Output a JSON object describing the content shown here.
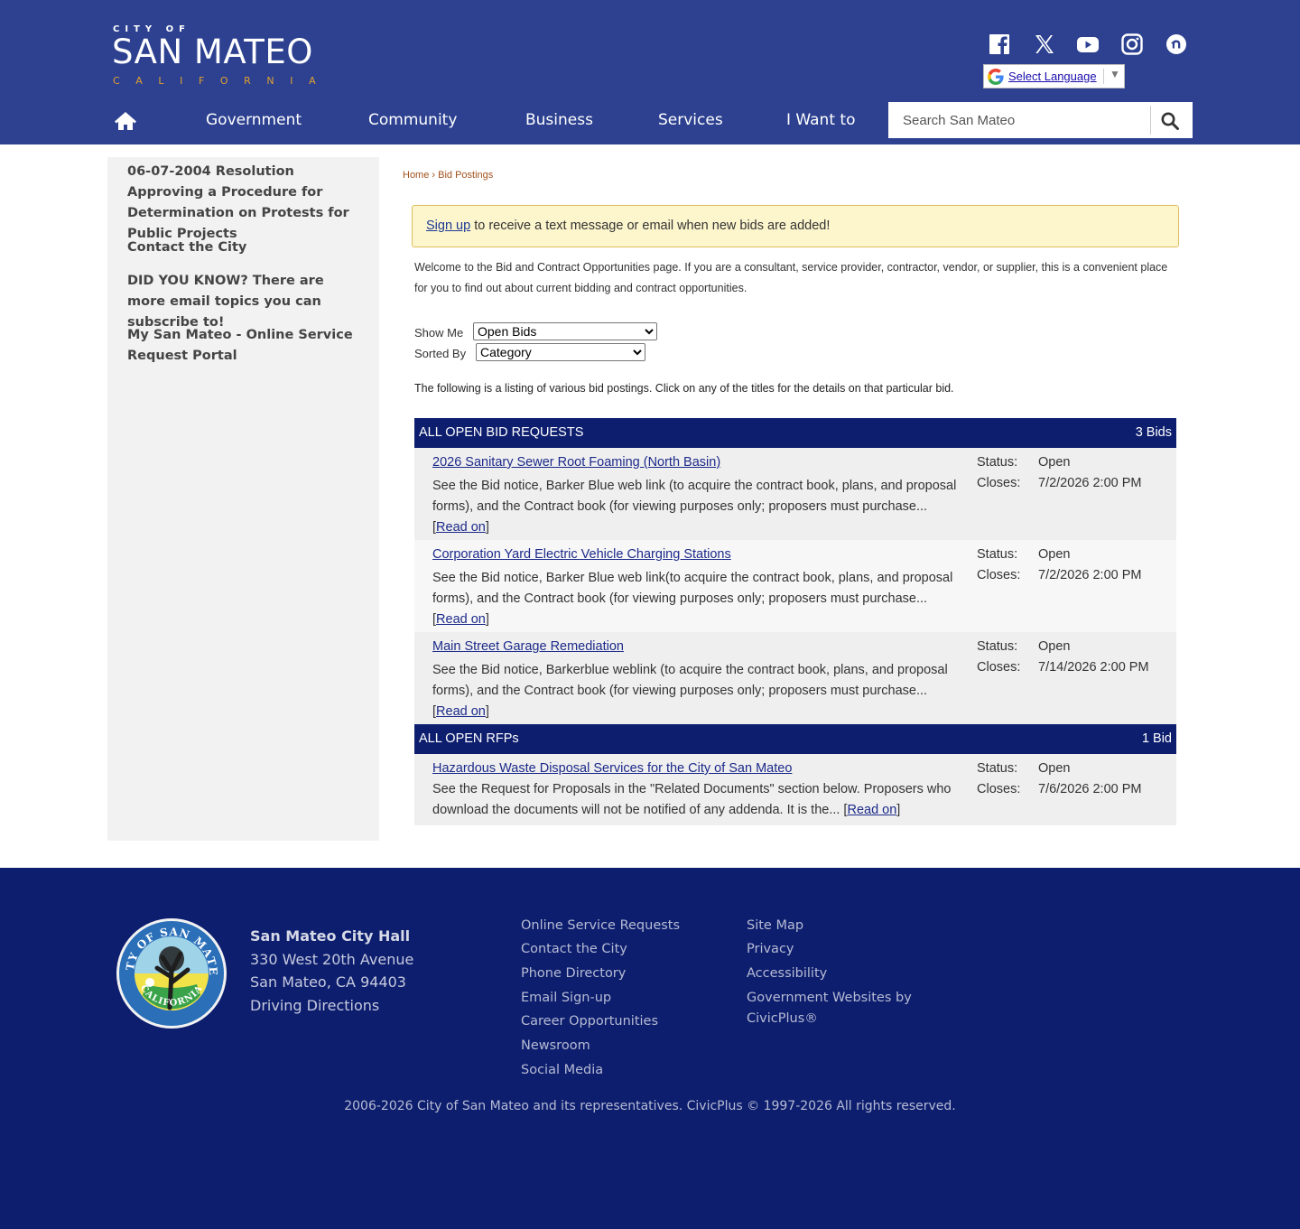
{
  "logo": {
    "line1": "CITY OF",
    "line2": "SAN MATEO",
    "line3": "CALIFORNIA"
  },
  "social": {
    "icons": [
      "facebook-icon",
      "x-twitter-icon",
      "youtube-icon",
      "instagram-icon",
      "nextdoor-icon"
    ]
  },
  "translate": {
    "label": "Select Language",
    "arrow": "▼"
  },
  "nav": {
    "items": [
      "Government",
      "Community",
      "Business",
      "Services",
      "I Want to"
    ]
  },
  "search": {
    "placeholder": "Search San Mateo"
  },
  "sidebar": {
    "items": [
      "06-07-2004 Resolution Approving a Procedure for Determination on Protests for Public Projects",
      "Contact the City",
      "DID YOU KNOW? There are more email topics you can subscribe to!",
      "My San Mateo - Online Service Request Portal"
    ]
  },
  "breadcrumb": {
    "home": "Home",
    "sep": " › ",
    "current": "Bid Postings"
  },
  "alert": {
    "link": "Sign up",
    "text": " to receive a text message or email when new bids are added!"
  },
  "intro": "Welcome to the Bid and Contract Opportunities page. If you are a consultant, service provider, contractor, vendor, or supplier, this is a convenient place for you to find out about current bidding and contract opportunities.",
  "filters": {
    "show_label": "Show Me",
    "show_value": "Open Bids",
    "sort_label": "Sorted By",
    "sort_value": "Category"
  },
  "listing_note": "The following is a listing of various bid postings. Click on any of the titles for the details on that particular bid.",
  "categories": [
    {
      "title": "ALL OPEN BID REQUESTS",
      "count": "3 Bids",
      "bids": [
        {
          "title": "2026 Sanitary Sewer Root Foaming (North Basin)",
          "desc": "See the Bid notice, Barker Blue web link (to acquire the contract book, plans, and proposal forms), and the Contract book (for viewing purposes only; proposers must purchase...",
          "read_on": "Read on",
          "status_label": "Status:",
          "status": "Open",
          "closes_label": "Closes:",
          "closes": "7/2/2026 2:00 PM"
        },
        {
          "title": "Corporation Yard Electric Vehicle Charging Stations",
          "desc": "See the Bid notice, Barker Blue web link(to acquire the contract book, plans, and proposal forms), and the Contract book (for viewing purposes only; proposers must purchase...",
          "read_on": "Read on",
          "status_label": "Status:",
          "status": "Open",
          "closes_label": "Closes:",
          "closes": "7/2/2026 2:00 PM"
        },
        {
          "title": "Main Street Garage Remediation",
          "desc": "See the Bid notice, Barkerblue weblink (to acquire the contract book, plans, and proposal forms), and the Contract book (for viewing purposes only; proposers must purchase...",
          "read_on": "Read on",
          "status_label": "Status:",
          "status": "Open",
          "closes_label": "Closes:",
          "closes": "7/14/2026 2:00 PM"
        }
      ]
    },
    {
      "title": "ALL OPEN RFPs",
      "count": "1 Bid",
      "bids": [
        {
          "title": "Hazardous Waste Disposal Services for the City of San Mateo",
          "desc": "See the Request for Proposals in the \"Related Documents\" section below. Proposers who download the documents will not be notified of any addenda. It is the...",
          "read_on": "Read on",
          "status_label": "Status:",
          "status": "Open",
          "closes_label": "Closes:",
          "closes": "7/6/2026 2:00 PM"
        }
      ]
    }
  ],
  "footer": {
    "seal_text": [
      "CITY OF",
      "SAN",
      "MATEO",
      "CALIFORNIA"
    ],
    "city_hall": {
      "name": "San Mateo City Hall",
      "address1": "330 West 20th Avenue",
      "address2": "San Mateo, CA 94403",
      "directions": "Driving Directions"
    },
    "col1": [
      "Online Service Requests",
      "Contact the City",
      "Phone Directory",
      "Email Sign-up",
      "Career Opportunities",
      "Newsroom",
      "Social Media"
    ],
    "col2": [
      "Site Map",
      "Privacy",
      "Accessibility",
      "Government Websites by",
      "CivicPlus®"
    ],
    "copyright": "2006-2026 City of San Mateo and its representatives. CivicPlus © 1997-2026 All rights reserved."
  },
  "colors": {
    "header_bg": "#2d4190",
    "nav_dark": "#0d1e6e",
    "accent_orange": "#e0a030",
    "alert_bg": "#fdf5cc"
  }
}
